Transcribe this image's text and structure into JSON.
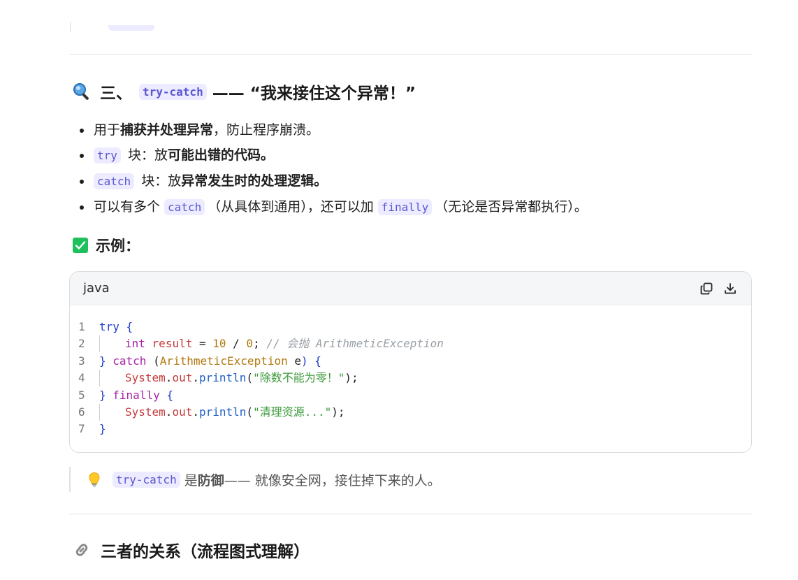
{
  "section3": {
    "prefix": "三、",
    "code": "try-catch",
    "suffix": "—— “我来接住这个异常！”",
    "icon": "magnifier-icon"
  },
  "bullets": [
    {
      "before": "用于",
      "bold": "捕获并处理异常",
      "after": "，防止程序崩溃。"
    },
    {
      "code": "try",
      "before": " 块：放",
      "bold": "可能出错的代码。"
    },
    {
      "code": "catch",
      "before": " 块：放",
      "bold": "异常发生时的处理逻辑。"
    },
    {
      "before": "可以有多个 ",
      "code1": "catch",
      "mid": "（从具体到通用），还可以加 ",
      "code2": "finally",
      "after": "（无论是否异常都执行）。"
    }
  ],
  "example": {
    "title": "示例："
  },
  "code_block": {
    "lang": "java",
    "copy_icon": "copy-icon",
    "download_icon": "download-icon",
    "line_numbers": [
      "1",
      "2",
      "3",
      "4",
      "5",
      "6",
      "7"
    ],
    "lines": {
      "l1_kw": "try",
      "l1_br": " {",
      "l2_type": "int",
      "l2_var": "result",
      "l2_eq": " = ",
      "l2_n1": "10",
      "l2_div": " / ",
      "l2_n2": "0",
      "l2_semi": "; ",
      "l2_cmt": "// 会抛 ArithmeticException",
      "l3_br": "}",
      "l3_kw": " catch",
      "l3_p1": " (",
      "l3_cls": "ArithmeticException",
      "l3_e": " e",
      "l3_p2": ") {",
      "l4_obj": "System",
      "l4_dot1": ".",
      "l4_out": "out",
      "l4_dot2": ".",
      "l4_fn": "println",
      "l4_p1": "(",
      "l4_str": "\"除数不能为零！\"",
      "l4_p2": ");",
      "l5_br": "}",
      "l5_kw": " finally",
      "l5_br2": " {",
      "l6_obj": "System",
      "l6_dot1": ".",
      "l6_out": "out",
      "l6_dot2": ".",
      "l6_fn": "println",
      "l6_p1": "(",
      "l6_str": "\"清理资源...\"",
      "l6_p2": ");",
      "l7_br": "}"
    }
  },
  "tip": {
    "icon": "lightbulb-icon",
    "code": "try-catch",
    "text1": "是 ",
    "bold": "防御",
    "text2": " —— 就像安全网，接住掉下来的人。"
  },
  "section4": {
    "icon": "link-icon",
    "title": "三者的关系（流程图式理解）"
  },
  "colors": {
    "accent_code_bg": "#ecebff",
    "accent_code_fg": "#5b57d1",
    "check_green": "#1ec05c"
  }
}
